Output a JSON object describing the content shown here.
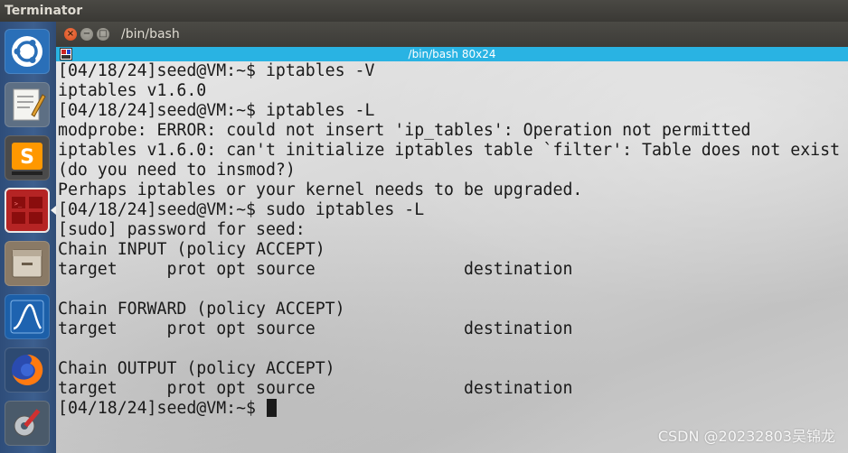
{
  "topbar": {
    "app_name": "Terminator"
  },
  "launcher": {
    "items": [
      {
        "icon": "ubuntu-logo-icon"
      },
      {
        "icon": "text-editor-icon"
      },
      {
        "icon": "sublime-text-icon"
      },
      {
        "icon": "terminator-icon"
      },
      {
        "icon": "file-manager-icon"
      },
      {
        "icon": "wireshark-icon"
      },
      {
        "icon": "firefox-icon"
      },
      {
        "icon": "system-settings-icon"
      }
    ]
  },
  "window": {
    "title": "/bin/bash",
    "close_glyph": "×",
    "minimize_glyph": "−",
    "maximize_glyph": "□"
  },
  "tab": {
    "title": "/bin/bash 80x24"
  },
  "terminal": {
    "lines": [
      "[04/18/24]seed@VM:~$ iptables -V",
      "iptables v1.6.0",
      "[04/18/24]seed@VM:~$ iptables -L",
      "modprobe: ERROR: could not insert 'ip_tables': Operation not permitted",
      "iptables v1.6.0: can't initialize iptables table `filter': Table does not exist",
      "(do you need to insmod?)",
      "Perhaps iptables or your kernel needs to be upgraded.",
      "[04/18/24]seed@VM:~$ sudo iptables -L",
      "[sudo] password for seed:",
      "Chain INPUT (policy ACCEPT)",
      "target     prot opt source               destination",
      "",
      "Chain FORWARD (policy ACCEPT)",
      "target     prot opt source               destination",
      "",
      "Chain OUTPUT (policy ACCEPT)",
      "target     prot opt source               destination"
    ],
    "prompt": "[04/18/24]seed@VM:~$ "
  },
  "watermark": "CSDN @20232803吴锦龙"
}
